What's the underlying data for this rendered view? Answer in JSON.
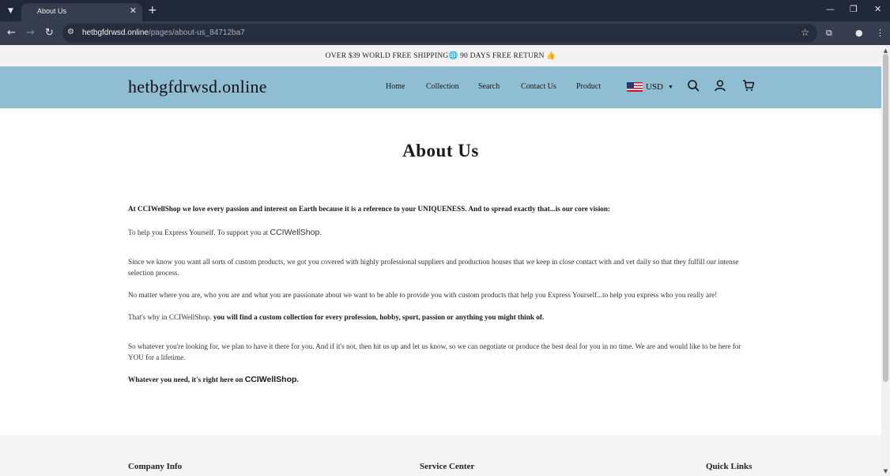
{
  "browser": {
    "tab_title": "About Us",
    "url_host": "hetbgfdrwsd.online",
    "url_path": "/pages/about-us_84712ba7"
  },
  "announcement": "OVER $39 WORLD FREE SHIPPING🌐 90 DAYS FREE RETURN 👍",
  "header": {
    "logo": "hetbgfdrwsd.online",
    "nav": [
      "Home",
      "Collection",
      "Search",
      "Contact Us",
      "Product"
    ],
    "currency": "USD"
  },
  "page": {
    "title": "About Us",
    "p1": "At CCIWellShop we love every passion and interest on Earth because it is a reference to your UNIQUENESS. And to spread exactly that...is our core vision:",
    "p2_text": "To help you Express Yourself. To support you at ",
    "p2_brand": "CCIWellShop.",
    "p3": "Since we know you want all sorts of custom products, we got you covered with highly professional suppliers and production houses that we keep in close contact with and vet daily so that they fulfill our intense selection process.",
    "p4": "No matter where you are, who you are and what you are passionate about we want to be able to provide you with custom products that help you Express Yourself...to help you express who you really are!",
    "p5_text": "That's why in CCIWellShop. ",
    "p5_bold": "you will find a custom collection for every profession, hobby, sport, passion or anything you might think of.",
    "p6": "So whatever you're looking for, we plan to have it there for you. And if it's not, then hit us up and let us know, so we can negotiate or produce the best deal for you in no time. We are and would like to be here for YOU for a lifetime.",
    "p7_text": "Whatever you need, it's right here on ",
    "p7_brand": "CCIWellShop",
    "p7_end": "."
  },
  "footer": {
    "company_info": "Company Info",
    "service_center": "Service Center",
    "quick_links": "Quick Links"
  }
}
